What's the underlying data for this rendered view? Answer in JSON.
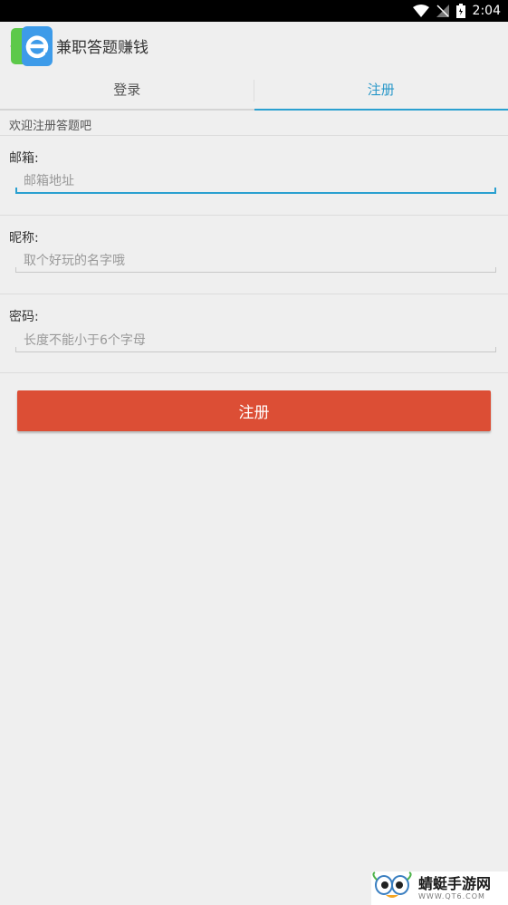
{
  "status_bar": {
    "time": "2:04"
  },
  "app_bar": {
    "title": "兼职答题赚钱",
    "back_glyph": "《",
    "icon_letter": "e"
  },
  "tabs": [
    {
      "label": "登录"
    },
    {
      "label": "注册"
    }
  ],
  "welcome_text": "欢迎注册答题吧",
  "form": {
    "email": {
      "label": "邮箱:",
      "placeholder": "邮箱地址"
    },
    "nickname": {
      "label": "昵称:",
      "placeholder": "取个好玩的名字哦"
    },
    "password": {
      "label": "密码:",
      "placeholder": "长度不能小于6个字母"
    }
  },
  "register_button": "注册",
  "watermark": {
    "title": "蜻蜓手游网",
    "url": "WWW.QT6.COM"
  },
  "colors": {
    "accent": "#2aa0d0",
    "button": "#dc4e35",
    "background": "#efefef"
  }
}
